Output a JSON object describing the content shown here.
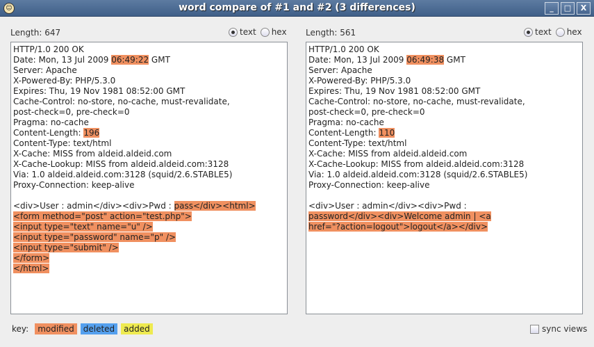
{
  "window": {
    "title": "word compare of #1 and #2  (3 differences)",
    "minimize": "_",
    "maximize": "□",
    "close": "X"
  },
  "colors": {
    "modified": "#f09060",
    "deleted": "#55a0ee",
    "added": "#eeea50"
  },
  "left": {
    "length_label": "Length: 647",
    "text_option": "text",
    "hex_option": "hex",
    "selected": "text",
    "lines": [
      [
        {
          "t": "HTTP/1.0 200 OK"
        }
      ],
      [
        {
          "t": "Date: Mon, 13 Jul 2009 "
        },
        {
          "t": "06:49:22",
          "hl": 1
        },
        {
          "t": " GMT"
        }
      ],
      [
        {
          "t": "Server: Apache"
        }
      ],
      [
        {
          "t": "X-Powered-By: PHP/5.3.0"
        }
      ],
      [
        {
          "t": "Expires: Thu, 19 Nov 1981 08:52:00 GMT"
        }
      ],
      [
        {
          "t": "Cache-Control: no-store, no-cache, must-revalidate,"
        }
      ],
      [
        {
          "t": "post-check=0, pre-check=0"
        }
      ],
      [
        {
          "t": "Pragma: no-cache"
        }
      ],
      [
        {
          "t": "Content-Length: "
        },
        {
          "t": "196",
          "hl": 1
        }
      ],
      [
        {
          "t": "Content-Type: text/html"
        }
      ],
      [
        {
          "t": "X-Cache: MISS from aldeid.aldeid.com"
        }
      ],
      [
        {
          "t": "X-Cache-Lookup: MISS from aldeid.aldeid.com:3128"
        }
      ],
      [
        {
          "t": "Via: 1.0 aldeid.aldeid.com:3128 (squid/2.6.STABLE5)"
        }
      ],
      [
        {
          "t": "Proxy-Connection: keep-alive"
        }
      ],
      [
        {
          "t": ""
        }
      ],
      [
        {
          "t": "<div>User : admin</div><div>Pwd : "
        },
        {
          "t": "pass</div><html>",
          "hl": 1
        }
      ],
      [
        {
          "t": "<form method=\"post\" action=\"test.php\">",
          "hl": 1
        }
      ],
      [
        {
          "t": "<input type=\"text\" name=\"u\" />",
          "hl": 1
        }
      ],
      [
        {
          "t": "<input type=\"password\" name=\"p\" />",
          "hl": 1
        }
      ],
      [
        {
          "t": "<input type=\"submit\" />",
          "hl": 1
        }
      ],
      [
        {
          "t": "</form>",
          "hl": 1
        }
      ],
      [
        {
          "t": "</html>",
          "hl": 1
        }
      ]
    ]
  },
  "right": {
    "length_label": "Length: 561",
    "text_option": "text",
    "hex_option": "hex",
    "selected": "text",
    "lines": [
      [
        {
          "t": "HTTP/1.0 200 OK"
        }
      ],
      [
        {
          "t": "Date: Mon, 13 Jul 2009 "
        },
        {
          "t": "06:49:38",
          "hl": 1
        },
        {
          "t": " GMT"
        }
      ],
      [
        {
          "t": "Server: Apache"
        }
      ],
      [
        {
          "t": "X-Powered-By: PHP/5.3.0"
        }
      ],
      [
        {
          "t": "Expires: Thu, 19 Nov 1981 08:52:00 GMT"
        }
      ],
      [
        {
          "t": "Cache-Control: no-store, no-cache, must-revalidate,"
        }
      ],
      [
        {
          "t": "post-check=0, pre-check=0"
        }
      ],
      [
        {
          "t": "Pragma: no-cache"
        }
      ],
      [
        {
          "t": "Content-Length: "
        },
        {
          "t": "110",
          "hl": 1
        }
      ],
      [
        {
          "t": "Content-Type: text/html"
        }
      ],
      [
        {
          "t": "X-Cache: MISS from aldeid.aldeid.com"
        }
      ],
      [
        {
          "t": "X-Cache-Lookup: MISS from aldeid.aldeid.com:3128"
        }
      ],
      [
        {
          "t": "Via: 1.0 aldeid.aldeid.com:3128 (squid/2.6.STABLE5)"
        }
      ],
      [
        {
          "t": "Proxy-Connection: keep-alive"
        }
      ],
      [
        {
          "t": ""
        }
      ],
      [
        {
          "t": "<div>User : admin</div><div>Pwd : "
        }
      ],
      [
        {
          "t": "password</div><div>Welcome admin | <a",
          "hl": 1
        }
      ],
      [
        {
          "t": "href=\"?action=logout\">logout</a></div>",
          "hl": 1
        }
      ]
    ]
  },
  "key": {
    "label": "key:",
    "modified": "modified",
    "deleted": "deleted",
    "added": "added"
  },
  "sync_views": {
    "label": "sync views",
    "checked": false
  }
}
